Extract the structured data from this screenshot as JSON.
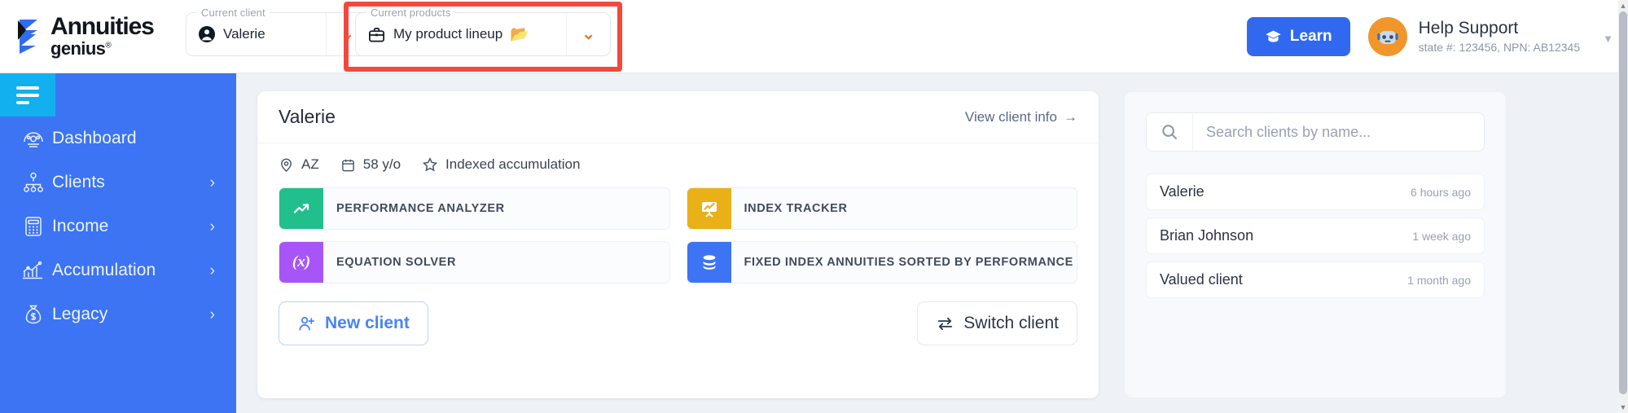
{
  "header": {
    "brand": {
      "top": "Annuities",
      "bottom": "genius",
      "reg": "®"
    },
    "client_selector": {
      "legend": "Current client",
      "value": "Valerie",
      "icon": "user-circle-icon",
      "caret": "chevron-down-icon"
    },
    "product_selector": {
      "legend": "Current products",
      "value": "My product lineup",
      "icon": "briefcase-icon",
      "folder_icon": "folder-icon",
      "caret": "chevron-down-icon"
    },
    "learn_button": {
      "label": "Learn",
      "icon": "graduation-cap-icon"
    },
    "support": {
      "name": "Help Support",
      "detail": "state #: 123456, NPN: AB12345",
      "avatar": "robot-avatar-icon",
      "caret": "chevron-down-icon"
    }
  },
  "sidebar": {
    "toggle": "hamburger-menu-icon",
    "items": [
      {
        "label": "Dashboard",
        "icon": "speedometer-icon",
        "chevron": ""
      },
      {
        "label": "Clients",
        "icon": "org-chart-icon",
        "chevron": "›"
      },
      {
        "label": "Income",
        "icon": "calculator-icon",
        "chevron": "›"
      },
      {
        "label": "Accumulation",
        "icon": "growth-chart-icon",
        "chevron": "›"
      },
      {
        "label": "Legacy",
        "icon": "money-bag-icon",
        "chevron": "›"
      }
    ]
  },
  "client_card": {
    "name": "Valerie",
    "view_link": "View client info",
    "view_link_arrow": "→",
    "meta": [
      {
        "icon": "location-pin-icon",
        "text": "AZ"
      },
      {
        "icon": "calendar-icon",
        "text": "58 y/o"
      },
      {
        "icon": "star-icon",
        "text": "Indexed accumulation"
      }
    ],
    "tiles": [
      {
        "label": "PERFORMANCE ANALYZER",
        "icon": "trend-up-icon",
        "color": "#21bf8b"
      },
      {
        "label": "INDEX TRACKER",
        "icon": "presentation-chart-icon",
        "color": "#e9b018"
      },
      {
        "label": "EQUATION SOLVER",
        "icon": "equation-icon",
        "color": "#a855f7"
      },
      {
        "label": "FIXED INDEX ANNUITIES SORTED BY PERFORMANCE",
        "icon": "database-stack-icon",
        "color": "#3d74f4"
      }
    ],
    "new_client_button": {
      "label": "New client",
      "icon": "user-plus-icon"
    },
    "switch_client_button": {
      "label": "Switch client",
      "icon": "swap-arrows-icon"
    }
  },
  "side_panel": {
    "search": {
      "placeholder": "Search clients by name...",
      "value": "",
      "icon": "search-icon"
    },
    "clients": [
      {
        "name": "Valerie",
        "time": "6 hours ago"
      },
      {
        "name": "Brian Johnson",
        "time": "1 week ago"
      },
      {
        "name": "Valued client",
        "time": "1 month ago"
      }
    ]
  },
  "annotation": {
    "type": "red-highlight-box",
    "target": "product_selector"
  },
  "colors": {
    "brand_blue": "#3d74f4",
    "accent_cyan": "#13b0ef",
    "learn_blue": "#3069f0",
    "caret_orange": "#f0792c",
    "annotation_red": "#f5483c"
  }
}
